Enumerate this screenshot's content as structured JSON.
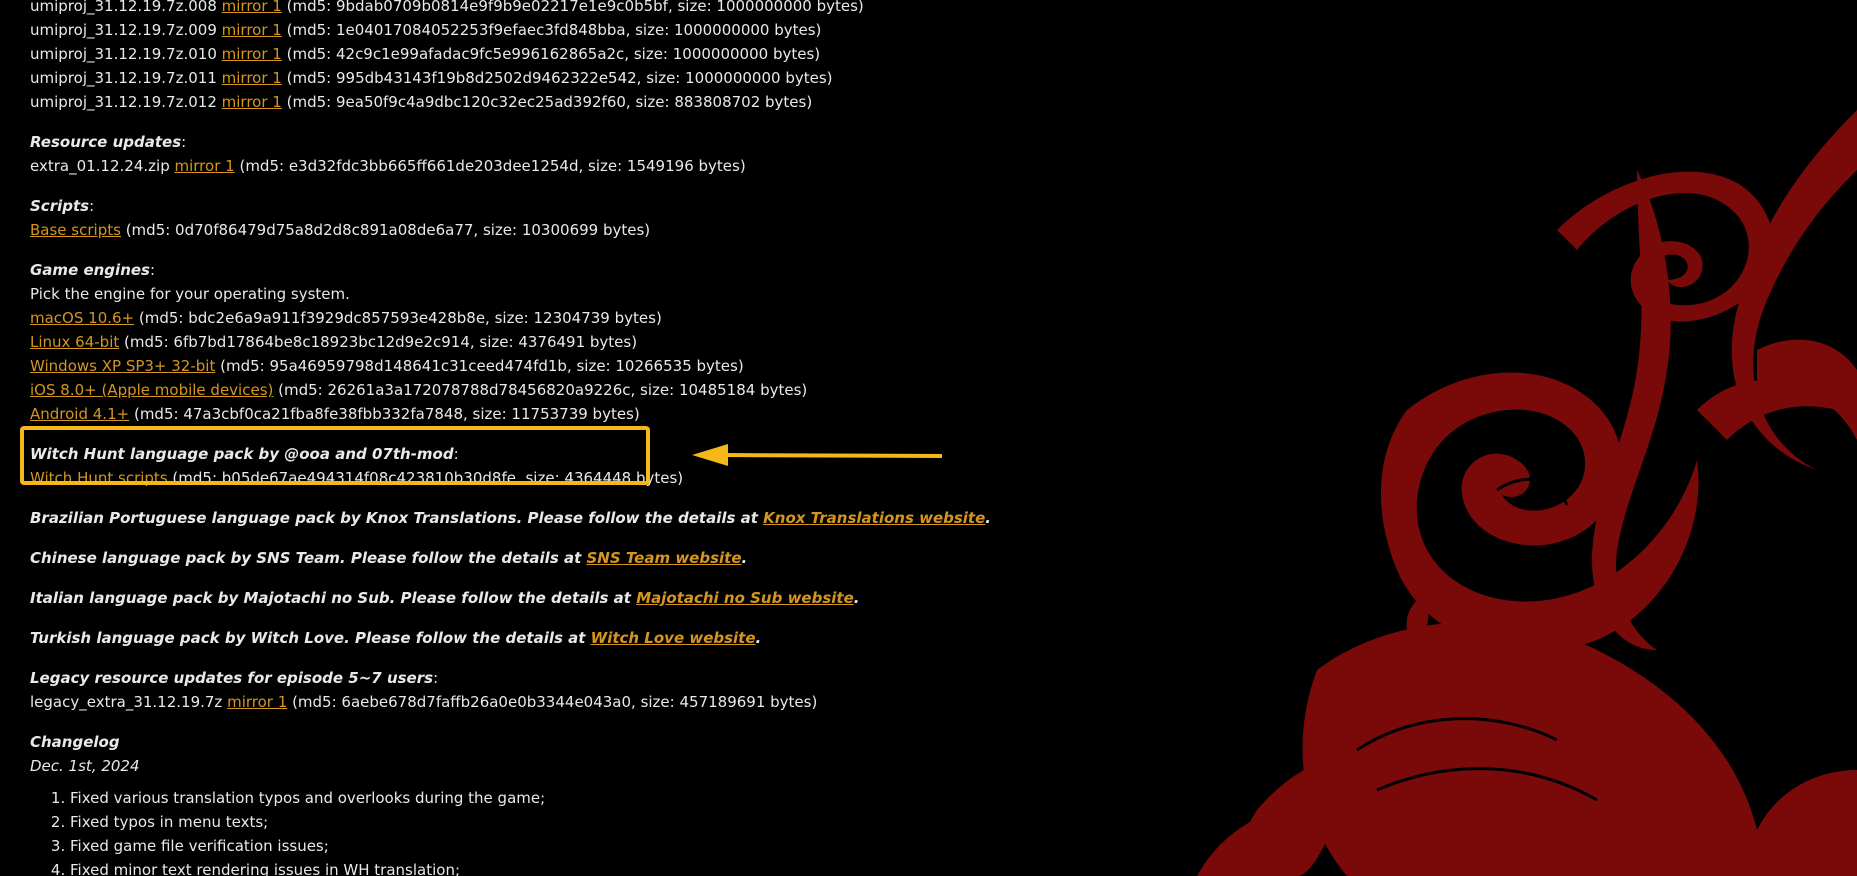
{
  "files": [
    {
      "name": "umiproj_31.12.19.7z.008",
      "mirror": "mirror 1",
      "info": "(md5: 9bdab0709b0814e9f9b9e02217e1e9c0b5bf, size: 1000000000 bytes)"
    },
    {
      "name": "umiproj_31.12.19.7z.009",
      "mirror": "mirror 1",
      "info": "(md5: 1e04017084052253f9efaec3fd848bba, size: 1000000000 bytes)"
    },
    {
      "name": "umiproj_31.12.19.7z.010",
      "mirror": "mirror 1",
      "info": "(md5: 42c9c1e99afadac9fc5e996162865a2c, size: 1000000000 bytes)"
    },
    {
      "name": "umiproj_31.12.19.7z.011",
      "mirror": "mirror 1",
      "info": "(md5: 995db43143f19b8d2502d9462322e542, size: 1000000000 bytes)"
    },
    {
      "name": "umiproj_31.12.19.7z.012",
      "mirror": "mirror 1",
      "info": "(md5: 9ea50f9c4a9dbc120c32ec25ad392f60, size: 883808702 bytes)"
    }
  ],
  "resource_updates": {
    "heading": "Resource updates",
    "colon": ":",
    "file": "extra_01.12.24.zip",
    "mirror": "mirror 1",
    "info": "(md5: e3d32fdc3bb665ff661de203dee1254d, size: 1549196 bytes)"
  },
  "scripts": {
    "heading": "Scripts",
    "colon": ":",
    "link": "Base scripts",
    "info": "(md5: 0d70f86479d75a8d2d8c891a08de6a77, size: 10300699 bytes)"
  },
  "engines": {
    "heading": "Game engines",
    "colon": ":",
    "note": "Pick the engine for your operating system.",
    "items": [
      {
        "link": "macOS 10.6+",
        "info": "(md5: bdc2e6a9a911f3929dc857593e428b8e, size: 12304739 bytes)"
      },
      {
        "link": "Linux 64-bit",
        "info": "(md5: 6fb7bd17864be8c18923bc12d9e2c914, size: 4376491 bytes)"
      },
      {
        "link": "Windows XP SP3+ 32-bit",
        "info": "(md5: 95a46959798d148641c31ceed474fd1b, size: 10266535 bytes)"
      },
      {
        "link": "iOS 8.0+ (Apple mobile devices)",
        "info": "(md5: 26261a3a172078788d78456820a9226c, size: 10485184 bytes)"
      },
      {
        "link": "Android 4.1+",
        "info": "(md5: 47a3cbf0ca21fba8fe38fbb332fa7848, size: 11753739 bytes)"
      }
    ]
  },
  "witch_hunt": {
    "heading": "Witch Hunt language pack by @ooa and 07th-mod",
    "colon": ":",
    "link": "Witch Hunt scripts",
    "info": "(md5: b05de67ae494314f08c423810b30d8fe, size: 4364448 bytes)"
  },
  "language_packs": [
    {
      "text": "Brazilian Portuguese language pack by Knox Translations. Please follow the details at ",
      "link": "Knox Translations website",
      "end": "."
    },
    {
      "text": "Chinese language pack by SNS Team. Please follow the details at ",
      "link": "SNS Team website",
      "end": "."
    },
    {
      "text": "Italian language pack by Majotachi no Sub. Please follow the details at ",
      "link": "Majotachi no Sub website",
      "end": "."
    },
    {
      "text": "Turkish language pack by Witch Love. Please follow the details at ",
      "link": "Witch Love website",
      "end": "."
    }
  ],
  "legacy": {
    "heading": "Legacy resource updates for episode 5~7 users",
    "colon": ":",
    "file": "legacy_extra_31.12.19.7z",
    "mirror": "mirror 1",
    "info": "(md5: 6aebe678d7faffb26a0e0b3344e043a0, size: 457189691 bytes)"
  },
  "changelog": {
    "heading": "Changelog",
    "date": "Dec. 1st, 2024",
    "items": [
      "Fixed various translation typos and overlooks during the game;",
      "Fixed typos in menu texts;",
      "Fixed game file verification issues;",
      "Fixed minor text rendering issues in WH translation;"
    ]
  },
  "colors": {
    "background": "#000000",
    "text": "#e9e9e9",
    "link": "#d4961e",
    "highlight": "#f6b817",
    "decoration": "#7a0a0a"
  }
}
